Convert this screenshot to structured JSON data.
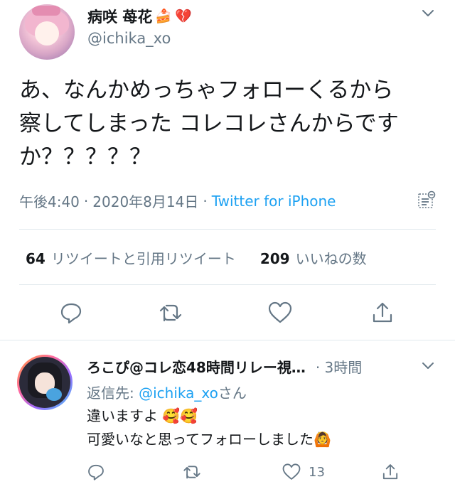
{
  "tweet": {
    "display_name": "病咲 苺花",
    "name_emojis": [
      "🍰",
      "💔"
    ],
    "handle": "@ichika_xo",
    "text_line1": "あ、なんかめっちゃフォローくるから",
    "text_line2": "察してしまった コレコレさんからです",
    "text_line3": "か？？？？？",
    "time": "午後4:40",
    "date": "2020年8月14日",
    "dot": "·",
    "source": "Twitter for iPhone",
    "retweets_count": "64",
    "retweets_label": "リツイートと引用リツイート",
    "likes_count": "209",
    "likes_label": "いいねの数"
  },
  "reply": {
    "display_name": "ろこぴ@コレ恋48時間リレー視…",
    "time": "· 3時間",
    "reply_prefix": "返信先: ",
    "reply_mention": "@ichika_xo",
    "reply_suffix": "さん",
    "line1": "違いますよ",
    "line1_emojis": "🥰🥰",
    "line2": "可愛いなと思ってフォローしました",
    "line2_emoji": "🙆",
    "likes_count": "13"
  },
  "colors": {
    "accent": "#1da1f2",
    "secondary_text": "#657786",
    "primary_text": "#14171a",
    "divider": "#e1e8ed"
  },
  "icons": {
    "menu": "chevron-down-icon",
    "analytics": "analytics-icon",
    "reply": "reply-icon",
    "retweet": "retweet-icon",
    "like": "heart-icon",
    "share": "share-icon"
  }
}
